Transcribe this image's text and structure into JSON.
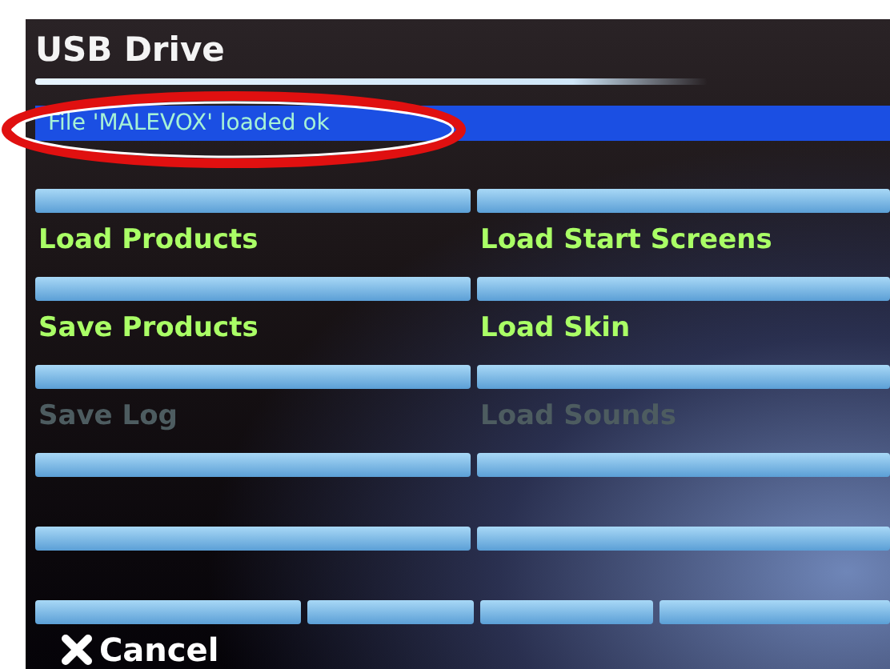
{
  "title": "USB Drive",
  "status": {
    "text": "File 'MALEVOX' loaded ok",
    "circled": true
  },
  "buttons": [
    {
      "kind": "action",
      "label": "Load Products",
      "disabled": false
    },
    {
      "kind": "action",
      "label": "Load Start Screens",
      "disabled": false
    },
    {
      "kind": "action",
      "label": "Save Products",
      "disabled": false
    },
    {
      "kind": "action",
      "label": "Load Skin",
      "disabled": false
    },
    {
      "kind": "action",
      "label": "Save Log",
      "disabled": true
    },
    {
      "kind": "action",
      "label": "Load Sounds",
      "disabled": true
    },
    {
      "kind": "blank"
    },
    {
      "kind": "blank"
    },
    {
      "kind": "blank"
    },
    {
      "kind": "blank"
    }
  ],
  "cancel": {
    "label": "Cancel"
  }
}
